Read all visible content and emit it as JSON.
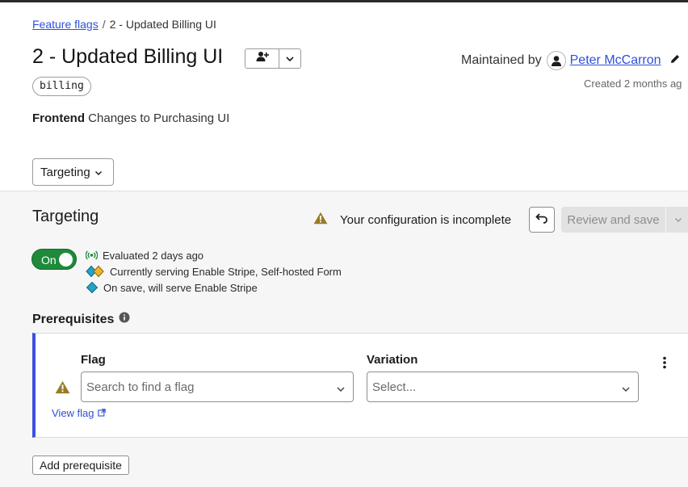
{
  "breadcrumb": {
    "root_link": "Feature flags",
    "separator": "/",
    "current": "2 - Updated Billing UI"
  },
  "flag": {
    "title": "2 - Updated Billing UI",
    "tag": "billing",
    "description_bold": "Frontend",
    "description_rest": "Changes to Purchasing UI",
    "maintained_label": "Maintained by",
    "maintainer": "Peter McCarron",
    "created": "Created 2 months ag"
  },
  "header_buttons": {
    "follow_icon": "add-person-icon",
    "dropdown_icon": "chevron-down-icon"
  },
  "view_select": {
    "label": "Targeting"
  },
  "targeting": {
    "title": "Targeting",
    "warning": "Your configuration is incomplete",
    "review_label": "Review and save",
    "toggle_label": "On",
    "toggle_on": true,
    "status": [
      {
        "icon": "broadcast-icon",
        "text": "Evaluated 2 days ago"
      },
      {
        "icon": "multi-variation-icon",
        "text": "Currently serving Enable Stripe, Self-hosted Form"
      },
      {
        "icon": "variation-diamond-icon",
        "text": "On save, will serve Enable Stripe"
      }
    ]
  },
  "prerequisites": {
    "title": "Prerequisites",
    "flag_label": "Flag",
    "flag_placeholder": "Search to find a flag",
    "variation_label": "Variation",
    "variation_placeholder": "Select...",
    "view_flag": "View flag",
    "add_button": "Add prerequisite"
  },
  "colors": {
    "accent_blue": "#3d4fe0",
    "link_blue": "#2f4fd8",
    "toggle_green": "#1e8a3a",
    "warning_amber": "#9a7a26",
    "diamond_teal": "#1fa5c6",
    "diamond_yellow": "#f0b429"
  }
}
